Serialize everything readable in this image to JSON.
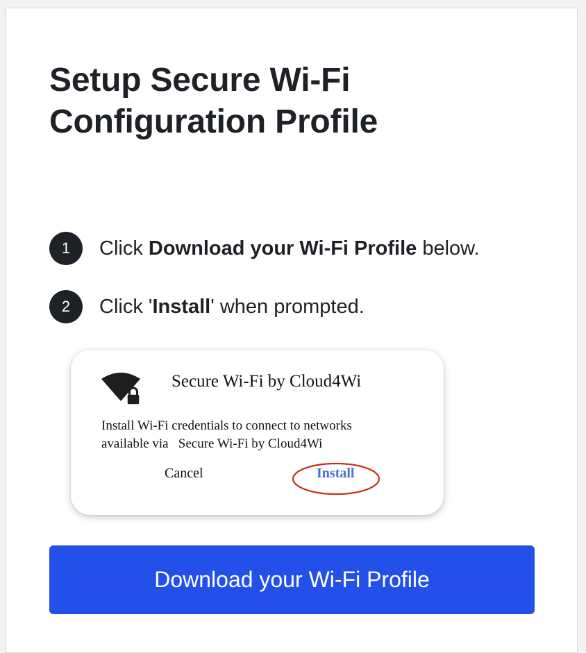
{
  "page": {
    "title": "Setup Secure Wi-Fi Configuration Profile"
  },
  "steps": [
    {
      "number": "1",
      "prefix": "Click ",
      "bold": "Download your Wi-Fi Profile",
      "suffix": " below."
    },
    {
      "number": "2",
      "prefix": "Click '",
      "bold": "Install",
      "suffix": "' when prompted."
    }
  ],
  "dialog": {
    "icon": "wifi-lock-icon",
    "title": "Secure Wi-Fi by Cloud4Wi",
    "line1": "Install Wi-Fi credentials to connect to networks",
    "line2": "available via   Secure Wi-Fi by Cloud4Wi",
    "cancel_label": "Cancel",
    "install_label": "Install",
    "highlight_color": "#cc2a1e"
  },
  "download_button": {
    "label": "Download your Wi-Fi Profile",
    "color": "#2350e8"
  }
}
